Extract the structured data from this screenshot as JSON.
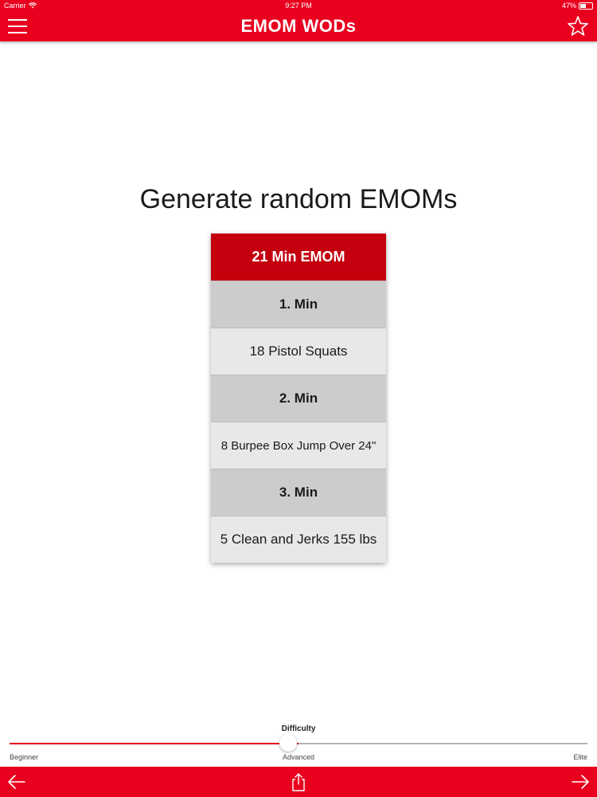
{
  "status_bar": {
    "carrier": "Carrier",
    "time": "9:27 PM",
    "battery": "47%",
    "battery_level": 0.47
  },
  "nav": {
    "title": "EMOM WODs",
    "left_icon": "hamburger-menu-icon",
    "right_icon": "star-icon"
  },
  "main": {
    "headline": "Generate random EMOMs"
  },
  "workout": {
    "header": "21 Min EMOM",
    "rows": [
      {
        "type": "minute",
        "label": "1. Min"
      },
      {
        "type": "exercise",
        "label": "18 Pistol Squats"
      },
      {
        "type": "minute",
        "label": "2. Min"
      },
      {
        "type": "exercise",
        "label": "8 Burpee Box Jump Over 24\""
      },
      {
        "type": "minute",
        "label": "3. Min"
      },
      {
        "type": "exercise",
        "label": "5 Clean and Jerks 155 lbs"
      }
    ]
  },
  "difficulty": {
    "label": "Difficulty",
    "min_label": "Beginner",
    "mid_label": "Advanced",
    "max_label": "Elite",
    "value": 0.5
  },
  "toolbar": {
    "back_icon": "arrow-left-icon",
    "share_icon": "share-icon",
    "forward_icon": "arrow-right-icon"
  },
  "colors": {
    "brand_red": "#e8001e",
    "header_red": "#c4000f",
    "minute_gray": "#cccccc",
    "exercise_gray": "#e8e8e8"
  }
}
